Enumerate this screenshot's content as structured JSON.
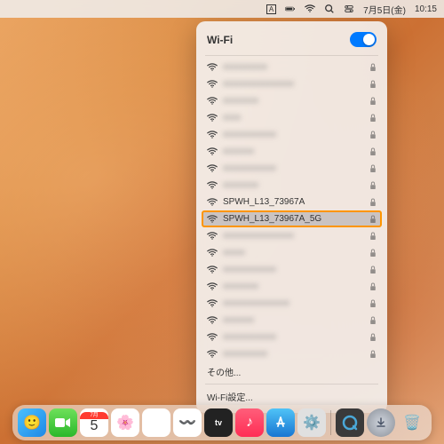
{
  "menubar": {
    "input": "A",
    "battery": "",
    "date": "7月5日(金)",
    "time": "10:15"
  },
  "wifi": {
    "title": "Wi-Fi",
    "networks": [
      {
        "name": "xxxxxxxxxx",
        "blur": true,
        "locked": true
      },
      {
        "name": "xxxxxxxxxxxxxxxx",
        "blur": true,
        "locked": true
      },
      {
        "name": "xxxxxxxx",
        "blur": true,
        "locked": true
      },
      {
        "name": "xxxx",
        "blur": true,
        "locked": true
      },
      {
        "name": "xxxxxxxxxxxx",
        "blur": true,
        "locked": true
      },
      {
        "name": "xxxxxxx",
        "blur": true,
        "locked": true
      },
      {
        "name": "xxxxxxxxxxxx",
        "blur": true,
        "locked": true
      },
      {
        "name": "xxxxxxxx",
        "blur": true,
        "locked": true
      },
      {
        "name": "SPWH_L13_73967A",
        "blur": false,
        "locked": true
      },
      {
        "name": "SPWH_L13_73967A_5G",
        "blur": false,
        "locked": true,
        "highlight": true
      },
      {
        "name": "xxxxxxxxxxxxxxxx",
        "blur": true,
        "locked": true
      },
      {
        "name": "xxxxx",
        "blur": true,
        "locked": true
      },
      {
        "name": "xxxxxxxxxxxx",
        "blur": true,
        "locked": true
      },
      {
        "name": "xxxxxxxx",
        "blur": true,
        "locked": true
      },
      {
        "name": "xxxxxxxxxxxxxxx",
        "blur": true,
        "locked": true
      },
      {
        "name": "xxxxxxx",
        "blur": true,
        "locked": true
      },
      {
        "name": "xxxxxxxxxxxx",
        "blur": true,
        "locked": true
      },
      {
        "name": "xxxxxxxxxx",
        "blur": true,
        "locked": true
      }
    ],
    "other": "その他...",
    "settings": "Wi-Fi設定..."
  },
  "dock": {
    "cal_month": "7月",
    "cal_day": "5"
  }
}
